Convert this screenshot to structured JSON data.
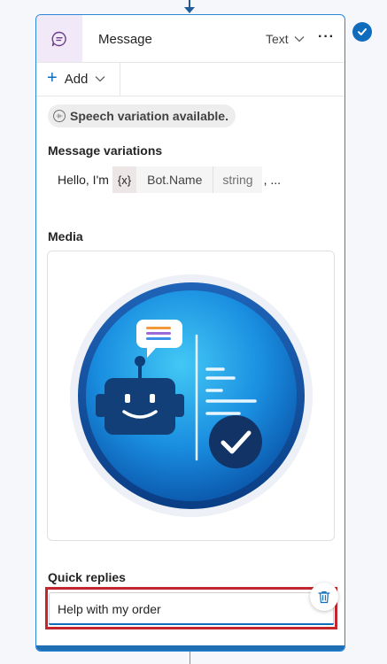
{
  "node": {
    "title": "Message",
    "type_selector": "Text",
    "more_label": "···"
  },
  "toolbar": {
    "add_label": "Add"
  },
  "speech_notice": "Speech variation available.",
  "message_variations": {
    "label": "Message variations",
    "prefix": "Hello, I'm",
    "variable_icon": "{x}",
    "variable_name": "Bot.Name",
    "variable_type": "string",
    "suffix": ", ..."
  },
  "media": {
    "label": "Media",
    "image": "bot-message-illustration"
  },
  "quick_replies": {
    "label": "Quick replies",
    "items": [
      {
        "text": "Help with my order"
      }
    ]
  },
  "icons": {
    "header": "chat-bubble-icon",
    "status": "checkmark-circle-icon",
    "delete": "trash-icon",
    "speech": "audio-wave-icon"
  },
  "colors": {
    "accent": "#0f6cbd",
    "highlight": "#c4262e",
    "header_icon_bg": "#f1e8f8"
  }
}
